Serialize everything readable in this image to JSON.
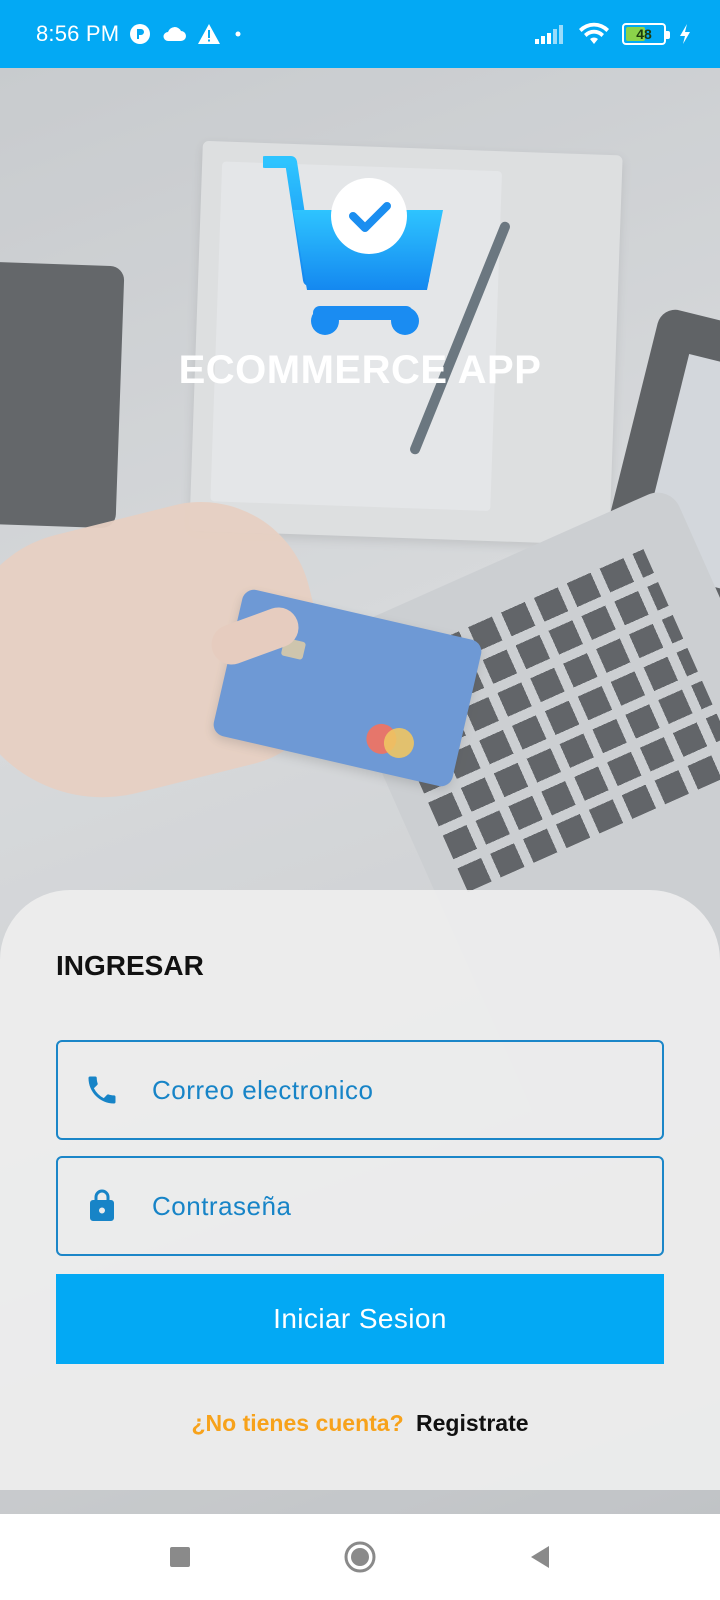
{
  "status_bar": {
    "time": "8:56 PM",
    "battery_level": "48",
    "icons": [
      "status-app-icon",
      "cloud-icon",
      "warning-icon",
      "dot-icon",
      "signal-icon",
      "wifi-icon",
      "battery-icon",
      "charging-icon"
    ]
  },
  "hero": {
    "logo_icon": "shopping-cart-check-icon",
    "app_title": "ECOMMERCE APP"
  },
  "login": {
    "title": "INGRESAR",
    "email_placeholder": "Correo electronico",
    "email_icon": "phone-icon",
    "password_placeholder": "Contraseña",
    "password_icon": "lock-icon",
    "submit_label": "Iniciar Sesion",
    "register_question": "¿No tienes cuenta?",
    "register_link": "Registrate"
  },
  "nav_bar": {
    "icons": [
      "recents-square-icon",
      "home-circle-icon",
      "back-triangle-icon"
    ]
  },
  "colors": {
    "primary": "#03a9f4",
    "field_border": "#1b86c8",
    "accent_orange": "#f7a21b"
  }
}
